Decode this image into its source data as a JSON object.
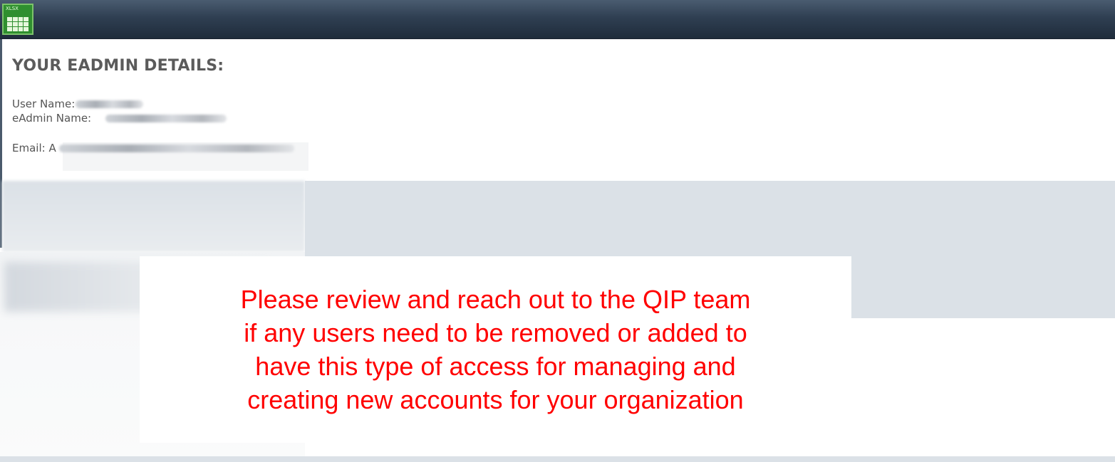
{
  "window": {
    "icon": "xlsx-spreadsheet-icon",
    "icon_tag": "XLSX"
  },
  "details": {
    "title": "YOUR EADMIN DETAILS:",
    "user_name_label": "User Name:",
    "eadmin_name_label": "eAdmin Name:",
    "email_label": "Email: A"
  },
  "notice": {
    "text": "Please review and reach out to the QIP team\nif any users need to be removed or added to\nhave this type of access for managing and\ncreating new accounts for your organization",
    "color": "#ff0000"
  },
  "colors": {
    "titlebar": "#2f3f52",
    "band": "#dbe1e7",
    "heading": "#5b5b5b"
  }
}
